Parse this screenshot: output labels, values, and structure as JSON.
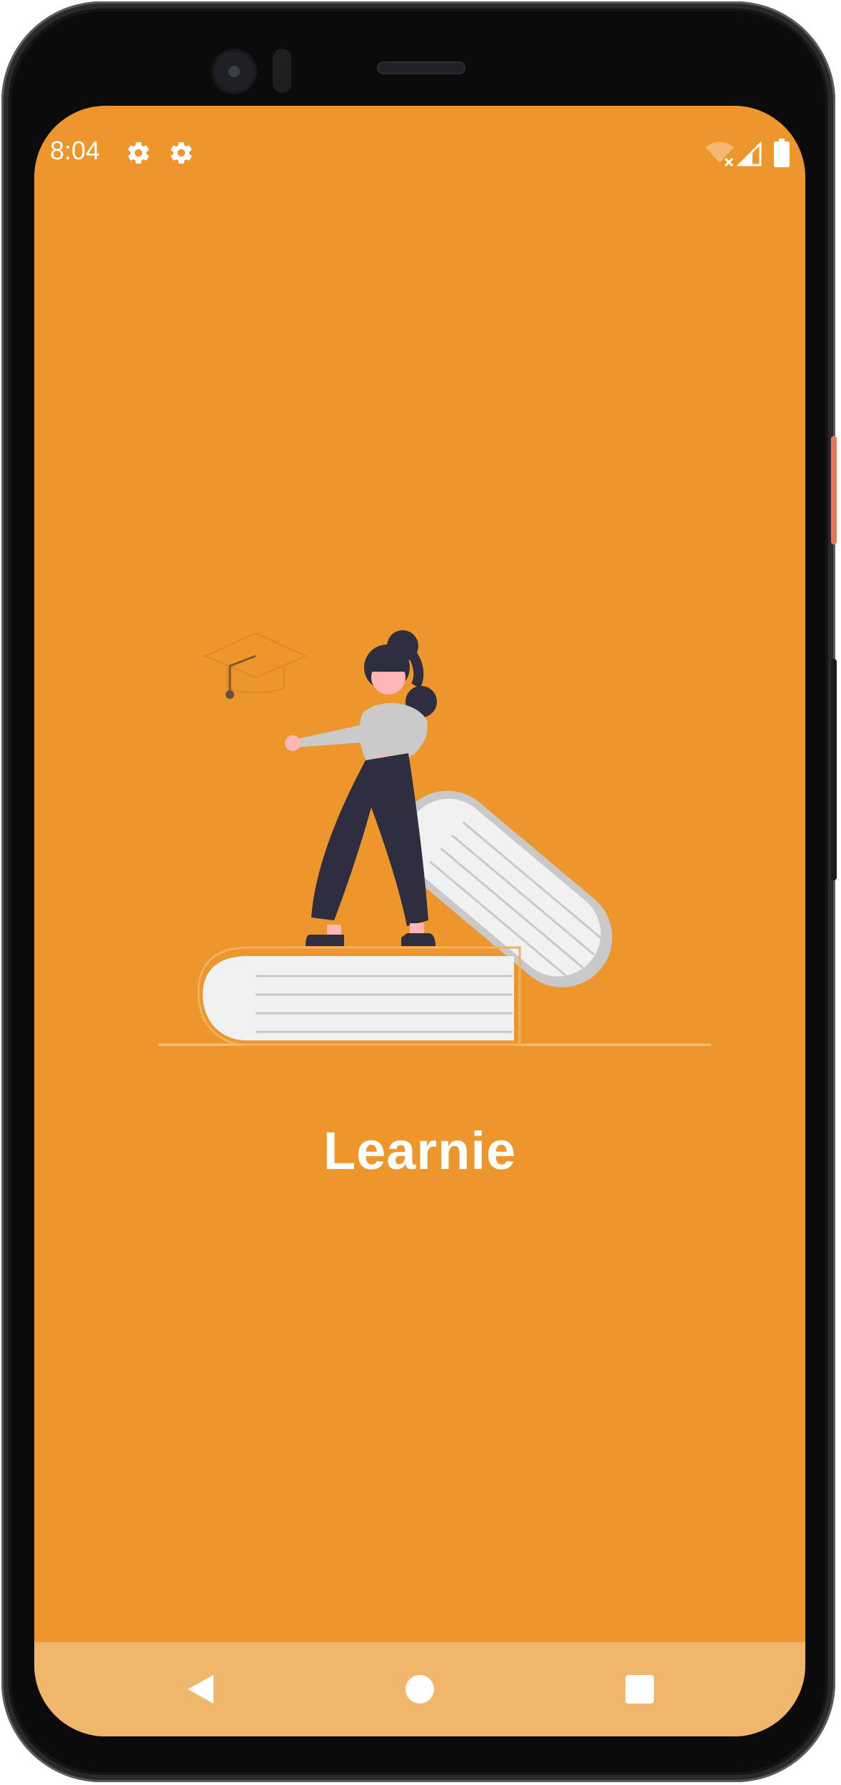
{
  "status_bar": {
    "time": "8:04",
    "icons": [
      "settings-gear-icon",
      "settings-gear-icon",
      "wifi-off-icon",
      "cellular-signal-icon",
      "battery-icon"
    ]
  },
  "app": {
    "title": "Learnie",
    "illustration": "woman-standing-on-books-with-graduation-cap"
  },
  "nav_bar": {
    "buttons": [
      "back-icon",
      "home-icon",
      "recents-icon"
    ]
  },
  "colors": {
    "background": "#ec962b",
    "nav_bar": "#f0b66b",
    "text": "#ffffff",
    "device_frame": "#151517"
  }
}
